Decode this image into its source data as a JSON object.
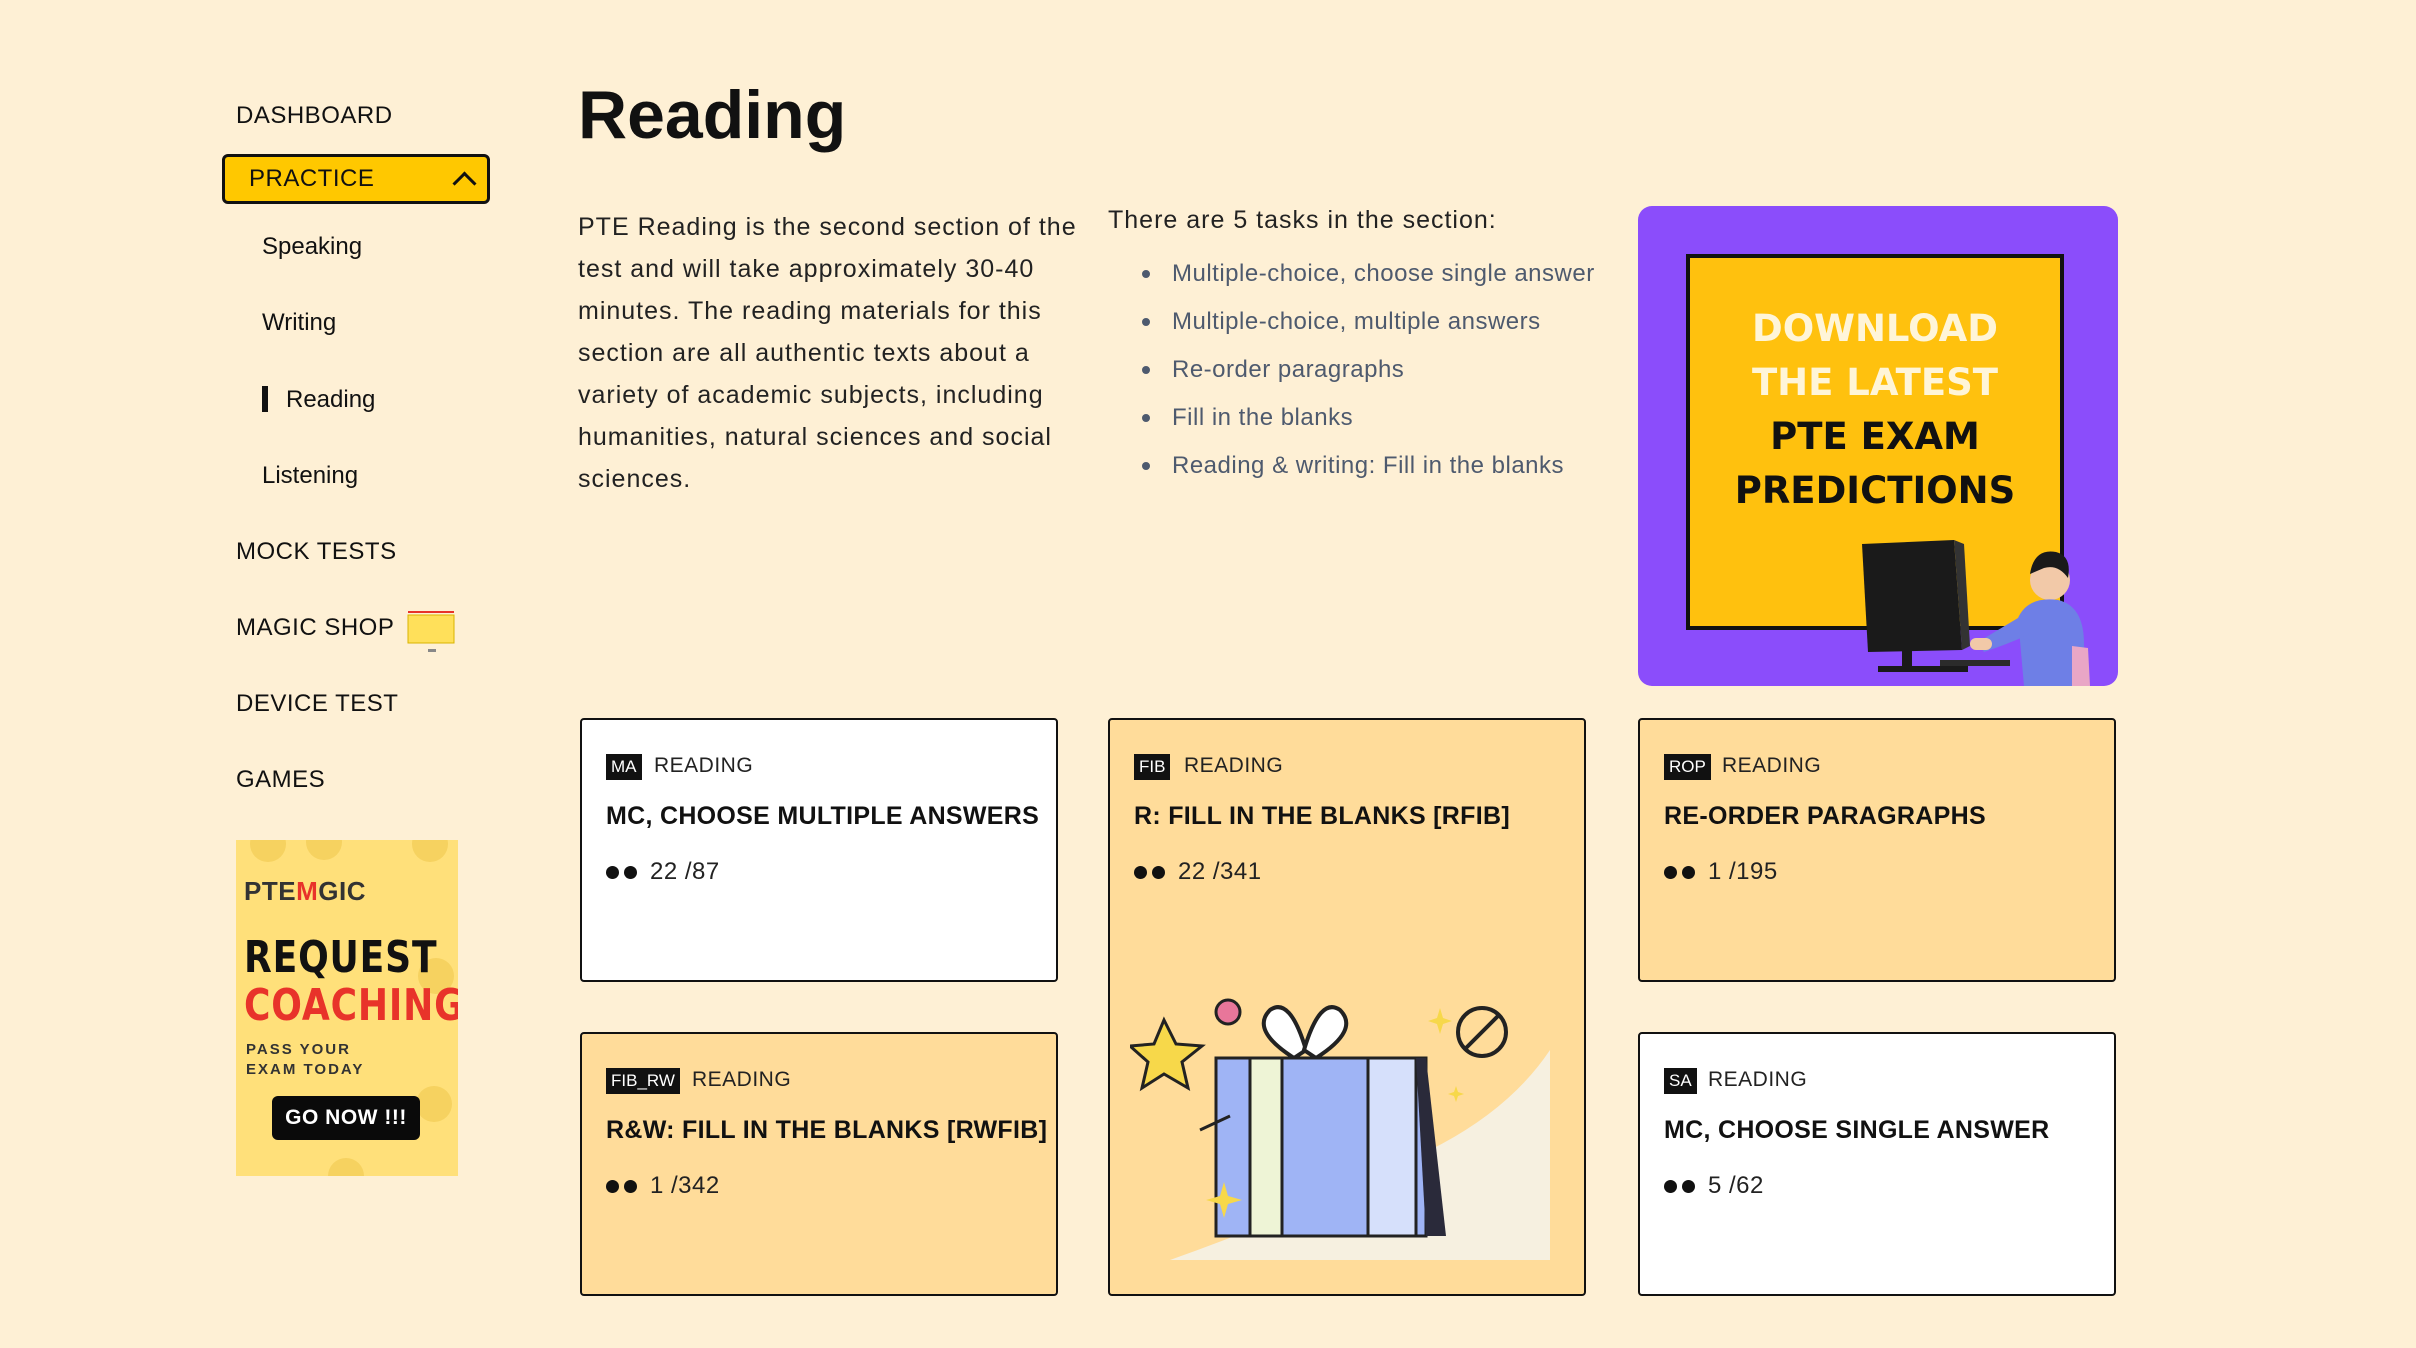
{
  "sidebar": {
    "dashboard": "DASHBOARD",
    "practice": "PRACTICE",
    "sub_items": [
      "Speaking",
      "Writing",
      "Reading",
      "Listening"
    ],
    "mock_tests": "MOCK TESTS",
    "magic_shop": "MAGIC SHOP",
    "device_test": "DEVICE TEST",
    "games": "GAMES"
  },
  "ad": {
    "logo_pre": "PTE",
    "logo_post": "GIC",
    "headline_1": "REQUEST",
    "headline_2": "COACHING",
    "subtext": "PASS YOUR EXAM TODAY",
    "button": "GO NOW !!!"
  },
  "page": {
    "title": "Reading",
    "intro": "PTE Reading is the second section of the test and will take approximately 30-40 minutes. The reading materials for this section are all authentic texts about a variety of academic subjects, including humanities, natural sciences and social sciences.",
    "tasks_heading": "There are 5 tasks in the section:",
    "tasks": [
      "Multiple-choice, choose single answer",
      "Multiple-choice, multiple answers",
      "Re-order paragraphs",
      "Fill in the blanks",
      "Reading & writing: Fill in the blanks"
    ]
  },
  "promo": {
    "line1": "DOWNLOAD",
    "line2": "THE LATEST",
    "line3": "PTE EXAM",
    "line4": "PREDICTIONS",
    "colors": {
      "background": "#8b4dfb",
      "box": "#ffc10e"
    }
  },
  "cards": [
    {
      "tag": "MA",
      "category": "READING",
      "title": "MC, CHOOSE MULTIPLE ANSWERS",
      "progress": "22 /87"
    },
    {
      "tag": "FIB",
      "category": "READING",
      "title": "R: FILL IN THE BLANKS [RFIB]",
      "progress": "22 /341"
    },
    {
      "tag": "ROP",
      "category": "READING",
      "title": "RE-ORDER PARAGRAPHS",
      "progress": "1 /195"
    },
    {
      "tag": "FIB_RW",
      "category": "READING",
      "title": "R&W: FILL IN THE BLANKS [RWFIB]",
      "progress": "1 /342"
    },
    {
      "tag": "SA",
      "category": "READING",
      "title": "MC, CHOOSE SINGLE ANSWER",
      "progress": "5 /62"
    }
  ],
  "colors": {
    "page_bg": "#fef0d5",
    "accent": "#ffc800",
    "card_warm": "#ffdc9a"
  }
}
